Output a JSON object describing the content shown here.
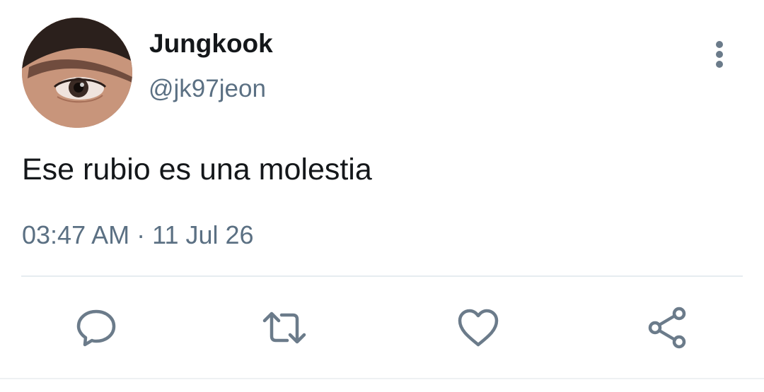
{
  "user": {
    "name": "Jungkook",
    "handle": "@jk97jeon"
  },
  "tweet": {
    "text": "Ese rubio es una molestia",
    "time": "03:47 AM",
    "separator": "·",
    "date": "11 Jul 26"
  },
  "actions": [
    {
      "icon": "reply-icon"
    },
    {
      "icon": "retweet-icon"
    },
    {
      "icon": "like-icon"
    },
    {
      "icon": "share-icon"
    }
  ],
  "colors": {
    "text": "#14171a",
    "secondary": "#5b7083",
    "icon": "#6b7b8a",
    "divider": "#e6ecf0",
    "background": "#ffffff"
  }
}
